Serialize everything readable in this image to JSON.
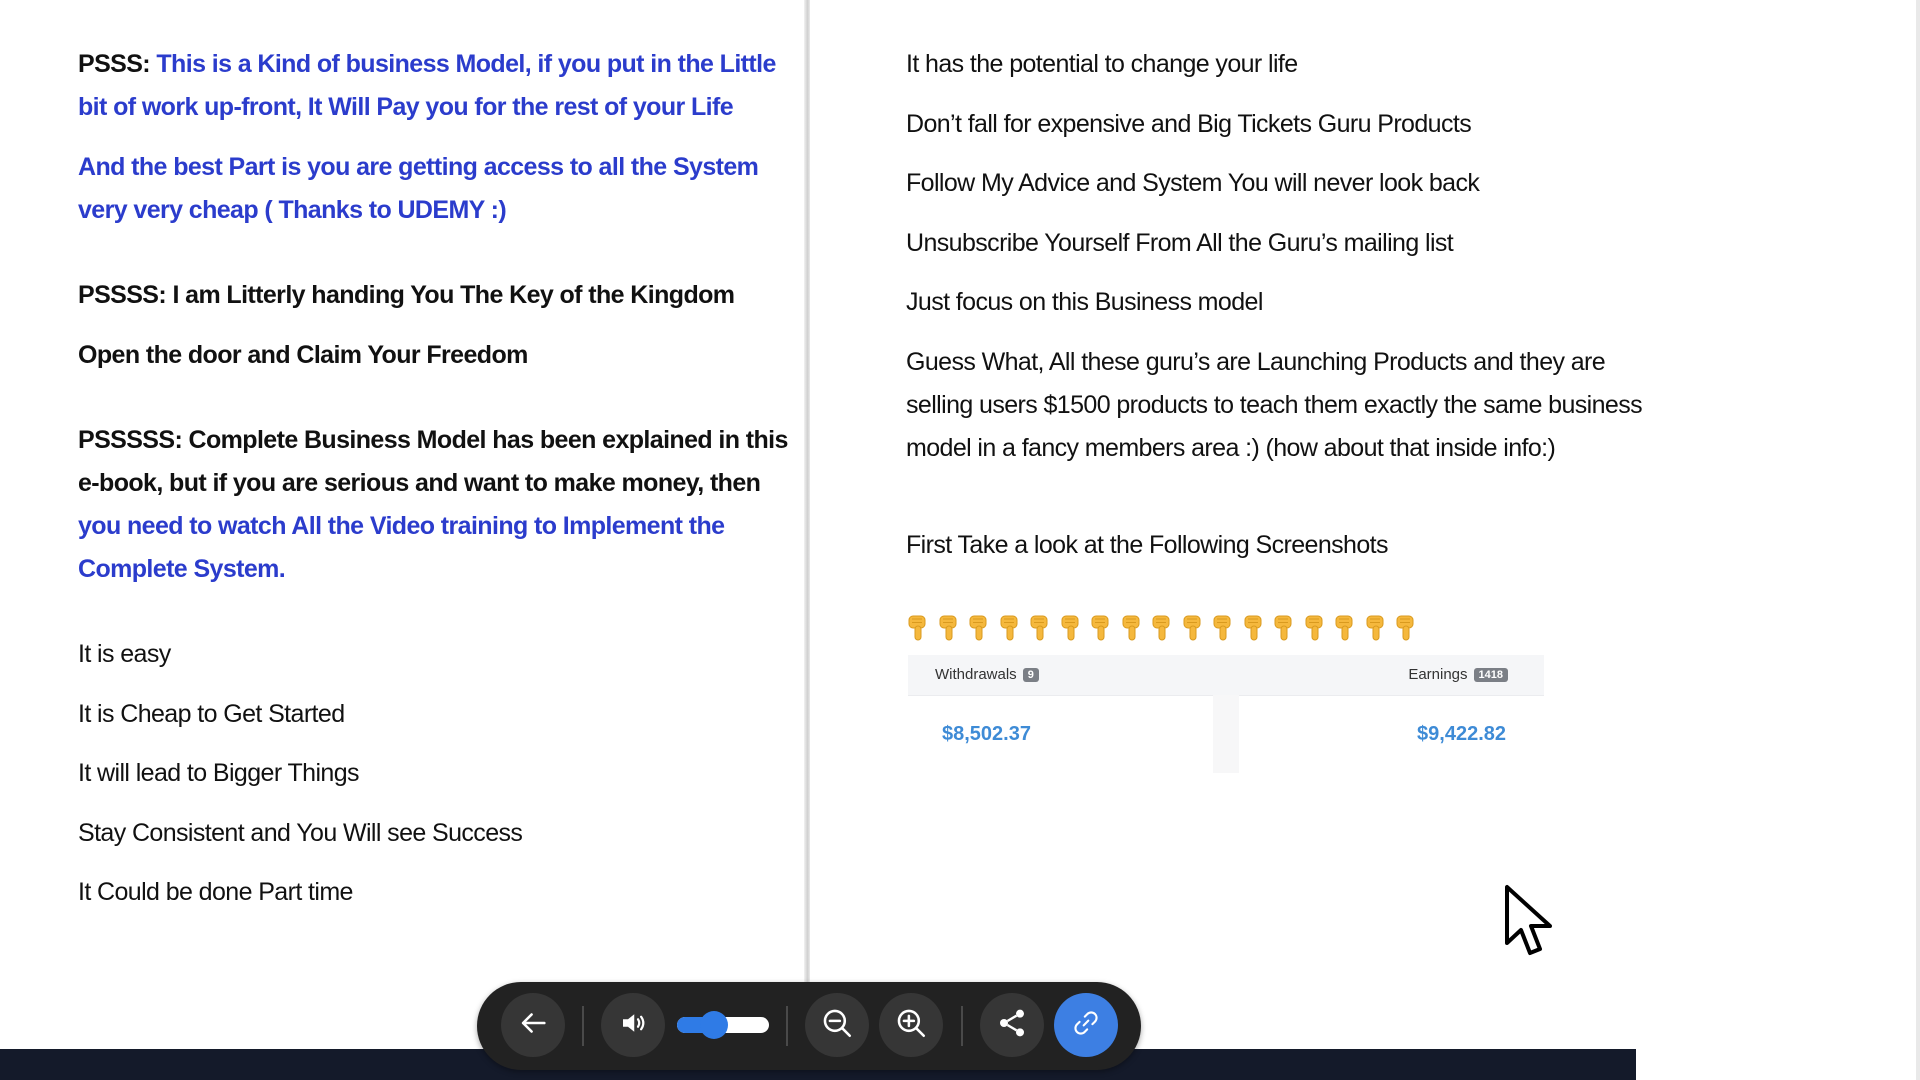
{
  "left_page": {
    "psss_prefix": "PSSS:",
    "psss_line1": "This is a Kind of business Model, if you put in the Little",
    "psss_line2": "bit of work up-front, It Will Pay you for the rest of your Life",
    "best_line1": "And the best Part is you are getting access to all the System",
    "best_line2": "very very cheap ( Thanks to UDEMY :)",
    "pssss": "PSSSS: I am Litterly handing You The Key of the Kingdom",
    "open_door": "Open the door and Claim Your Freedom",
    "psssss_line1": "PSSSSS: Complete Business Model has been explained in this",
    "psssss_line2": "e-book, but if you are serious and want to make money, then",
    "psssss_line3": "you need to watch All the Video training to Implement the",
    "psssss_line4": "Complete System.",
    "list": [
      "It is easy",
      "It is Cheap to Get Started",
      "It will lead to Bigger Things",
      "Stay Consistent and You Will see Success",
      "It Could be done Part time"
    ]
  },
  "right_page": {
    "lines": [
      "It has the potential to change your life",
      "Don’t fall for expensive and Big Tickets Guru Products",
      "Follow My Advice and System You will never look back",
      "Unsubscribe Yourself From All the Guru’s mailing list",
      "Just focus on this Business model"
    ],
    "guess_line1": "Guess What, All these guru’s are Launching Products and they are",
    "guess_line2": "selling users $1500 products to teach them exactly the same business",
    "guess_line3": "model in a fancy members area :) (how about that inside info:)",
    "screenshots_heading": "First Take a look at the Following Screenshots",
    "pointer_count": 17,
    "stats": {
      "withdrawals_label": "Withdrawals",
      "withdrawals_badge": "9",
      "withdrawals_value": "$8,502.37",
      "earnings_label": "Earnings",
      "earnings_badge": "1418",
      "earnings_value": "$9,422.82"
    }
  },
  "toolbar": {
    "back_icon": "arrow-left-icon",
    "volume_icon": "speaker-icon",
    "volume_level_percent": 40,
    "zoom_out_icon": "zoom-out-icon",
    "zoom_in_icon": "zoom-in-icon",
    "share_icon": "share-icon",
    "link_icon": "link-icon",
    "accent_color": "#3d7fe3"
  },
  "colors": {
    "blue_text": "#2b3ccc",
    "stat_value": "#3e8bd6",
    "pointer_emoji": "#f5b83d"
  }
}
